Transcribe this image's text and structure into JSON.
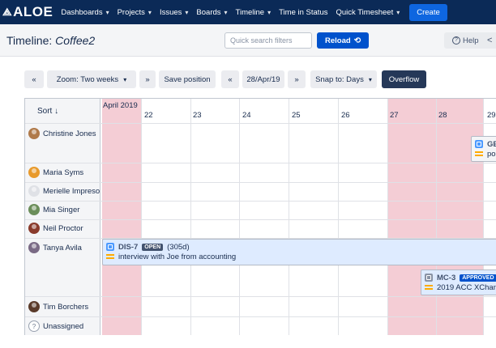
{
  "nav": {
    "logo": "ALOE",
    "items": [
      {
        "label": "Dashboards",
        "caret": true
      },
      {
        "label": "Projects",
        "caret": true
      },
      {
        "label": "Issues",
        "caret": true
      },
      {
        "label": "Boards",
        "caret": true
      },
      {
        "label": "Timeline",
        "caret": true
      },
      {
        "label": "Time in Status",
        "caret": false
      },
      {
        "label": "Quick Timesheet",
        "caret": true
      }
    ],
    "create_label": "Create"
  },
  "header": {
    "title_prefix": "Timeline: ",
    "title_name": "Coffee2",
    "search_placeholder": "Quick search filters",
    "reload_label": "Reload",
    "help_label": "Help"
  },
  "toolbar": {
    "prev_label": "«",
    "zoom_label": "Zoom: Two weeks",
    "next_label": "»",
    "save_label": "Save position",
    "date_prev_label": "«",
    "date_label": "28/Apr/19",
    "date_next_label": "»",
    "snap_label": "Snap to: Days",
    "overflow_label": "Overflow"
  },
  "timeline": {
    "sort_label": "Sort ↓",
    "month_label": "April 2019",
    "days": [
      "22",
      "23",
      "24",
      "25",
      "26",
      "27",
      "28",
      "29"
    ],
    "weekend_days": [
      "21",
      "27",
      "28"
    ],
    "people": [
      {
        "name": "Christine Jones",
        "avatar_color": "#b07a4a"
      },
      {
        "name": "Maria Syms",
        "avatar_color": "#e89a2c"
      },
      {
        "name": "Merielle Impreso",
        "avatar_color": ""
      },
      {
        "name": "Mia Singer",
        "avatar_color": "#6b8e5a"
      },
      {
        "name": "Neil Proctor",
        "avatar_color": "#8a3b2c"
      },
      {
        "name": "Tanya Avila",
        "avatar_color": "#7a6a85"
      },
      {
        "name": "Tim Borchers",
        "avatar_color": "#5a3a2a"
      },
      {
        "name": "Unassigned",
        "avatar_color": ""
      }
    ],
    "cards": [
      {
        "key": "GE",
        "status": "",
        "duration": "",
        "summary": "pol",
        "type_color": "#4c9aff"
      },
      {
        "key": "DIS-7",
        "status": "OPEN",
        "duration": "(305d)",
        "summary": "interview with Joe from accounting",
        "type_color": "#4c9aff"
      },
      {
        "key": "MC-3",
        "status": "APPROVED",
        "duration": "",
        "summary": "2019 ACC XChan",
        "type_color": "#8993a4"
      }
    ]
  }
}
